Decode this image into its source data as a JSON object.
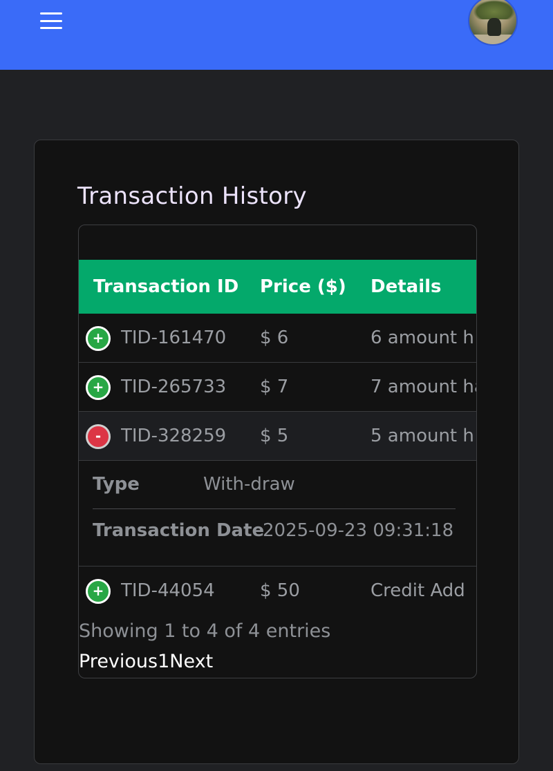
{
  "header": {
    "menu_icon": "hamburger-menu-icon",
    "avatar": "user-avatar-photo",
    "bg_color": "#3a6bf8"
  },
  "page": {
    "title": "Transaction History"
  },
  "table": {
    "header_color": "#04a96b",
    "columns": [
      "Transaction ID",
      "Price ($)",
      "Details"
    ],
    "rows": [
      {
        "toggle": "+",
        "id": "TID-161470",
        "price": "$ 6",
        "details": "6 amount h",
        "expanded": false
      },
      {
        "toggle": "+",
        "id": "TID-265733",
        "price": "$ 7",
        "details": "7 amount ha",
        "expanded": false
      },
      {
        "toggle": "-",
        "id": "TID-328259",
        "price": "$ 5",
        "details": "5 amount h",
        "expanded": true
      },
      {
        "toggle": "+",
        "id": "TID-44054",
        "price": "$ 50",
        "details": "Credit Add",
        "expanded": false
      }
    ],
    "expanded_detail": {
      "type_label": "Type",
      "type_value": "With-draw",
      "date_label": "Transaction Date",
      "date_value": "2025-09-23 09:31:18"
    },
    "info": "Showing 1 to 4 of 4 entries",
    "pagination": {
      "previous": "Previous",
      "page": "1",
      "next": "Next"
    }
  }
}
